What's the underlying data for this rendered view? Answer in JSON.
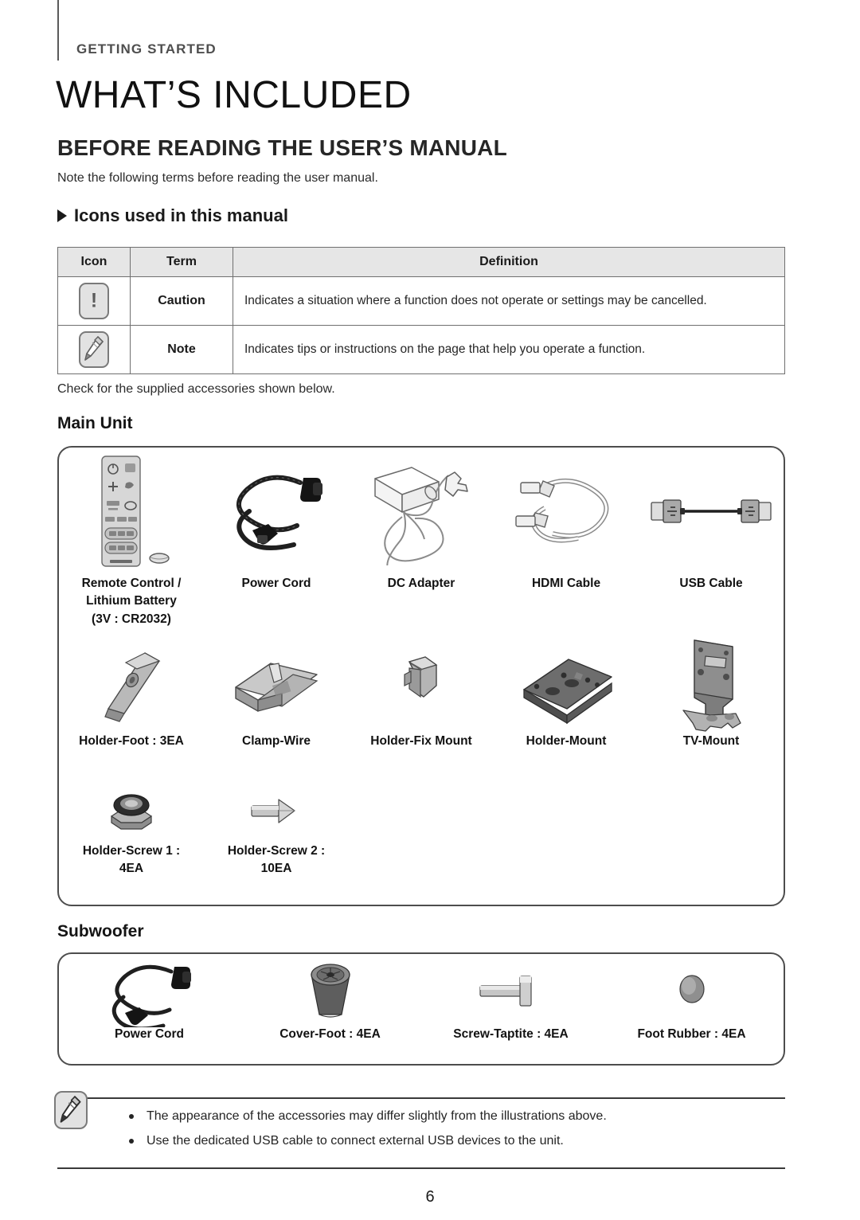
{
  "header": {
    "eyebrow": "GETTING STARTED",
    "chapter_title": "WHAT’S INCLUDED",
    "section_title": "BEFORE READING THE USER’S MANUAL",
    "lead_text": "Note the following terms before reading the user manual.",
    "subhead": "Icons used in this manual"
  },
  "legend_table": {
    "headers": [
      "Icon",
      "Term",
      "Definition"
    ],
    "rows": [
      {
        "icon": "caution-icon",
        "term": "Caution",
        "definition": "Indicates a situation where a function does not operate or settings may be cancelled."
      },
      {
        "icon": "note-icon",
        "term": "Note",
        "definition": "Indicates tips or instructions on the page that help you operate a function."
      }
    ]
  },
  "accessories": {
    "check_text": "Check for the supplied accessories shown below.",
    "main_unit": {
      "label": "Main Unit",
      "row1": [
        {
          "icon": "remote-control-icon",
          "label": "Remote Control /\nLithium Battery\n(3V : CR2032)"
        },
        {
          "icon": "power-cord-icon",
          "label": "Power Cord"
        },
        {
          "icon": "dc-adapter-icon",
          "label": "DC Adapter"
        },
        {
          "icon": "hdmi-cable-icon",
          "label": "HDMI Cable"
        },
        {
          "icon": "usb-cable-icon",
          "label": "USB Cable"
        }
      ],
      "row2": [
        {
          "icon": "holder-foot-icon",
          "label": "Holder-Foot : 3EA"
        },
        {
          "icon": "clamp-wire-icon",
          "label": "Clamp-Wire"
        },
        {
          "icon": "holder-fix-mount-icon",
          "label": "Holder-Fix Mount"
        },
        {
          "icon": "holder-mount-icon",
          "label": "Holder-Mount"
        },
        {
          "icon": "tv-mount-icon",
          "label": "TV-Mount"
        }
      ],
      "row3": [
        {
          "icon": "holder-screw-1-icon",
          "label": "Holder-Screw 1 :\n4EA"
        },
        {
          "icon": "holder-screw-2-icon",
          "label": "Holder-Screw 2 :\n10EA"
        }
      ]
    },
    "subwoofer": {
      "label": "Subwoofer",
      "items": [
        {
          "icon": "power-cord-icon",
          "label": "Power Cord"
        },
        {
          "icon": "cover-foot-icon",
          "label": "Cover-Foot : 4EA"
        },
        {
          "icon": "screw-taptite-icon",
          "label": "Screw-Taptite : 4EA"
        },
        {
          "icon": "foot-rubber-icon",
          "label": "Foot Rubber : 4EA"
        }
      ]
    }
  },
  "footer_note": {
    "icon": "note-icon",
    "items": [
      "The appearance of the accessories may differ slightly from the illustrations above.",
      "Use the dedicated USB cable to connect external USB devices to the unit."
    ]
  },
  "page_number": "6",
  "colors": {
    "rule": "#5a5a5a",
    "table_header_bg": "#e6e6e6",
    "box_border": "#4d4d4d",
    "text": "#1a1a1a"
  }
}
